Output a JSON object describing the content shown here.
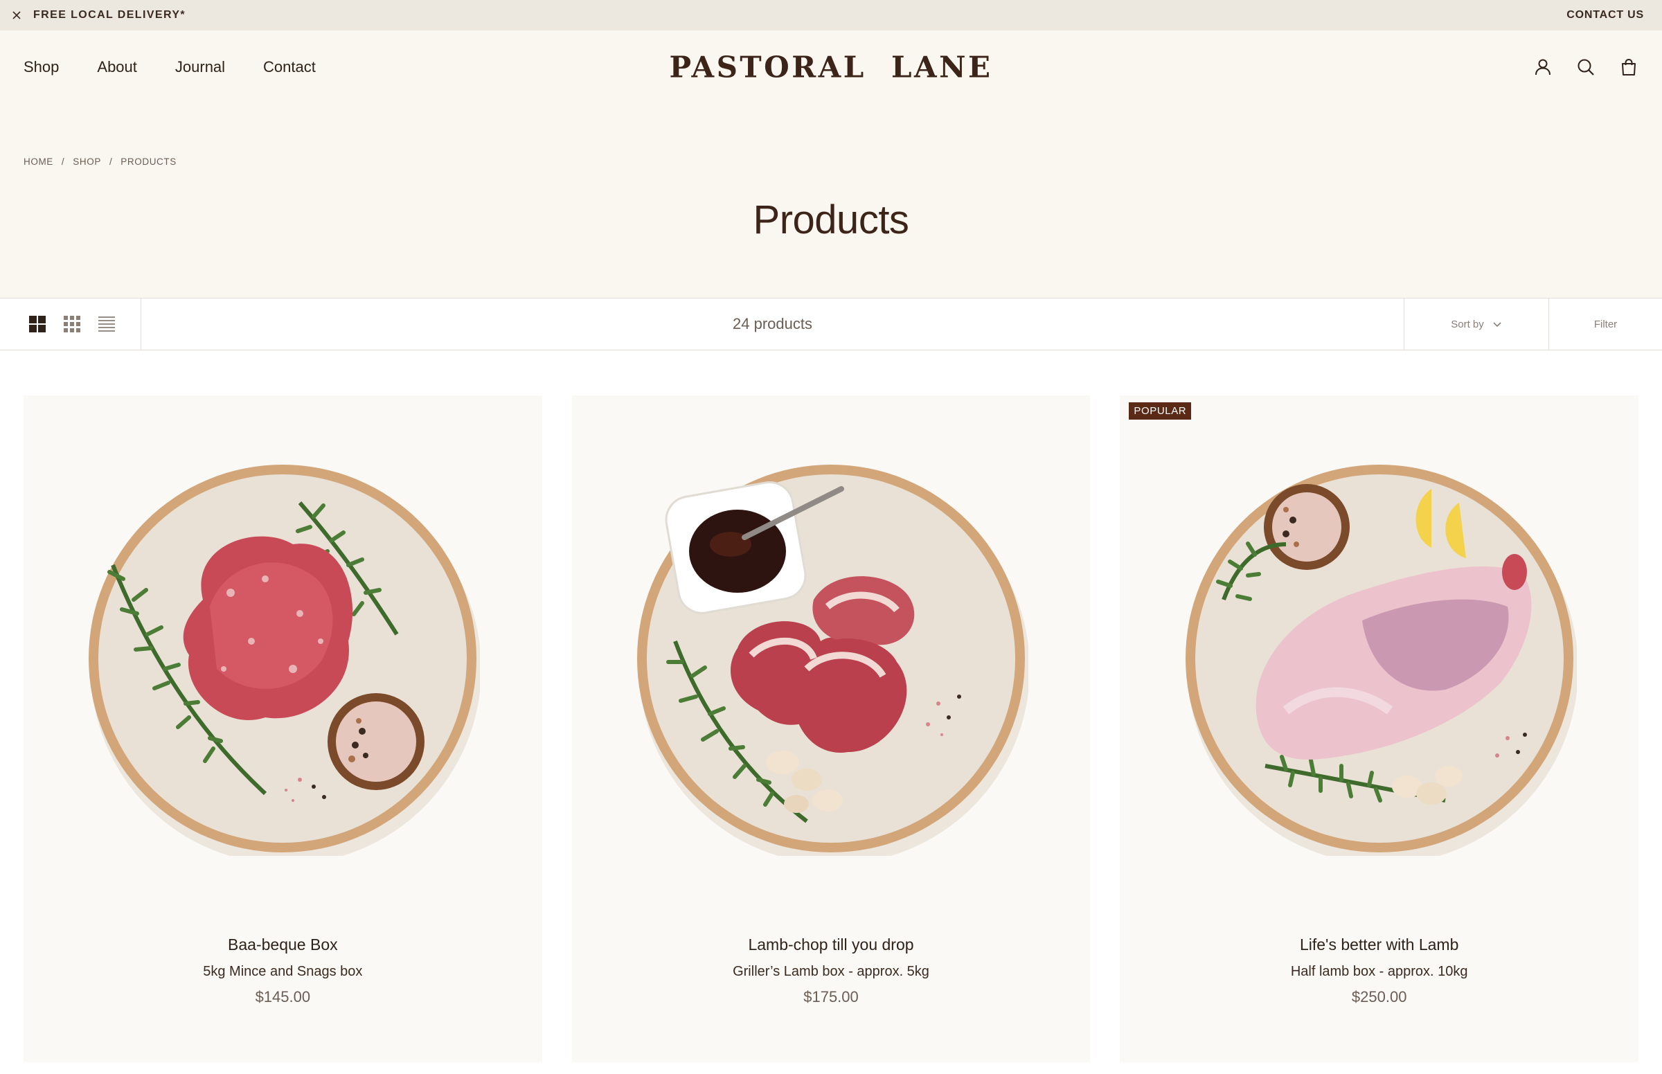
{
  "announcement": {
    "text": "FREE LOCAL DELIVERY*",
    "contact_label": "CONTACT US"
  },
  "header": {
    "nav": [
      "Shop",
      "About",
      "Journal",
      "Contact"
    ],
    "logo": "PASTORAL  LANE",
    "icons": [
      "account-icon",
      "search-icon",
      "bag-icon"
    ]
  },
  "breadcrumb": [
    "HOME",
    "/",
    "SHOP",
    "/",
    "PRODUCTS"
  ],
  "page": {
    "title": "Products"
  },
  "toolbar": {
    "count": "24 products",
    "sort_label": "Sort by",
    "filter_label": "Filter"
  },
  "products": [
    {
      "title": "Baa-beque Box",
      "subtitle": "5kg Mince and Snags box",
      "price": "$145.00",
      "badge": ""
    },
    {
      "title": "Lamb-chop till you drop",
      "subtitle": "Griller’s Lamb box - approx. 5kg",
      "price": "$175.00",
      "badge": ""
    },
    {
      "title": "Life's better with Lamb",
      "subtitle": "Half lamb box - approx. 10kg",
      "price": "$250.00",
      "badge": "POPULAR"
    }
  ],
  "colors": {
    "brand": "#3c2418",
    "announcement_bg": "#ece8df",
    "hero_bg": "#faf7f0",
    "badge_bg": "#5a2a16"
  }
}
